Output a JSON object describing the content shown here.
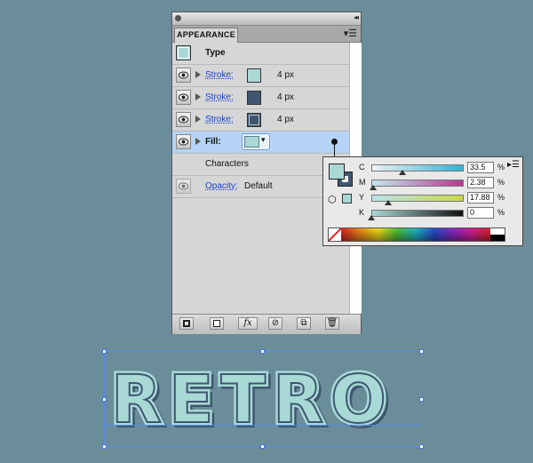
{
  "panel": {
    "tab_label": "APPEARANCE",
    "menu_icon": "panel-menu-icon",
    "object_type": "Type",
    "rows": [
      {
        "label": "Stroke:",
        "swatch": "#a8d9d5",
        "size": "4 px"
      },
      {
        "label": "Stroke:",
        "swatch": "#3f5670",
        "size": "4 px"
      },
      {
        "label": "Stroke:",
        "swatch": "#3f5670",
        "size": "4 px"
      }
    ],
    "fill": {
      "label": "Fill:",
      "swatch": "#a8d9d5"
    },
    "characters_label": "Characters",
    "opacity": {
      "label": "Opacity:",
      "value": "Default"
    },
    "bottom_buttons": [
      "add-new-stroke-icon",
      "add-new-fill-icon",
      "add-new-effect-icon",
      "clear-appearance-icon",
      "duplicate-item-icon",
      "delete-item-icon"
    ],
    "effect_glyph": "fx"
  },
  "color_popup": {
    "channels": [
      {
        "letter": "C",
        "value": "33.5",
        "unit": "%",
        "level": 0.335
      },
      {
        "letter": "M",
        "value": "2.38",
        "unit": "%",
        "level": 0.0238
      },
      {
        "letter": "Y",
        "value": "17.88",
        "unit": "%",
        "level": 0.1788
      },
      {
        "letter": "K",
        "value": "0",
        "unit": "%",
        "level": 0
      }
    ],
    "fill_color": "#a8d9d5",
    "stroke_color": "#3f5670"
  },
  "artwork": {
    "text": "RETRO",
    "fill_color": "#a8d9d5",
    "outline_color": "#3f5670",
    "selection_color": "#4a78e0"
  }
}
